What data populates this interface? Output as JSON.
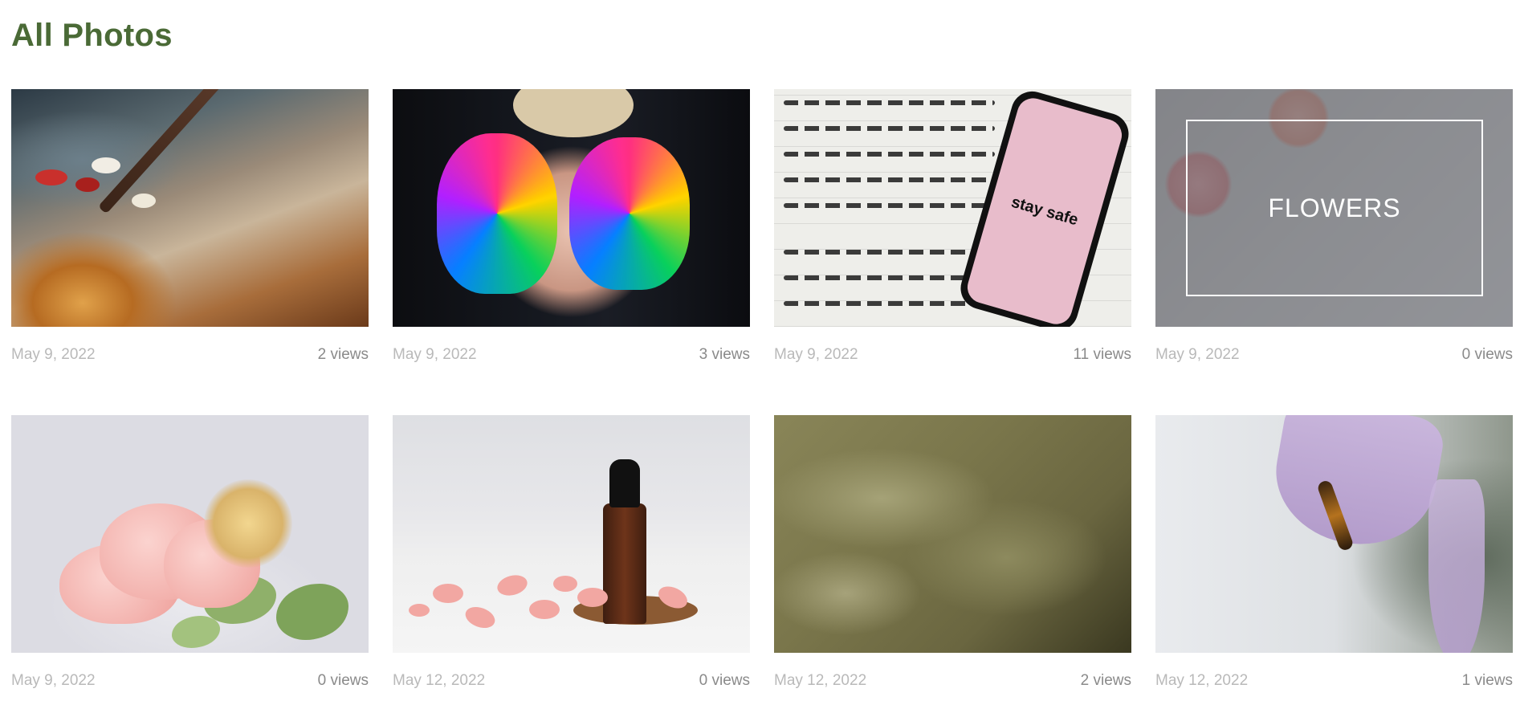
{
  "page": {
    "title": "All Photos"
  },
  "photos": [
    {
      "date": "May 9, 2022",
      "views": "2 views",
      "overlay_label": ""
    },
    {
      "date": "May 9, 2022",
      "views": "3 views",
      "overlay_label": ""
    },
    {
      "date": "May 9, 2022",
      "views": "11 views",
      "overlay_label": "",
      "phone_text": "stay safe"
    },
    {
      "date": "May 9, 2022",
      "views": "0 views",
      "overlay_label": "FLOWERS"
    },
    {
      "date": "May 9, 2022",
      "views": "0 views",
      "overlay_label": ""
    },
    {
      "date": "May 12, 2022",
      "views": "0 views",
      "overlay_label": ""
    },
    {
      "date": "May 12, 2022",
      "views": "2 views",
      "overlay_label": ""
    },
    {
      "date": "May 12, 2022",
      "views": "1 views",
      "overlay_label": ""
    }
  ],
  "colors": {
    "title": "#4a6a36",
    "date_text": "#b9b9b9",
    "views_text": "#8a8a8a"
  }
}
